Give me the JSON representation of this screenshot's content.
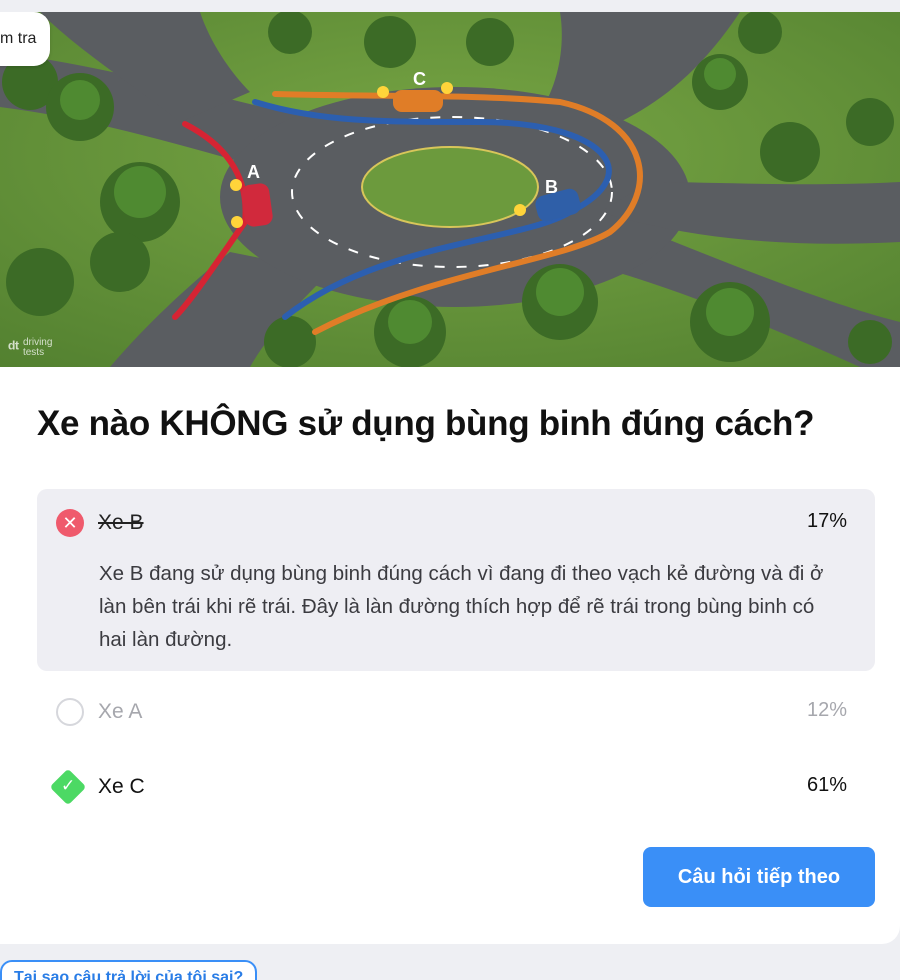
{
  "tag": {
    "label": "m tra"
  },
  "hero": {
    "watermark": "driving\ntests",
    "labels": [
      "A",
      "B",
      "C"
    ]
  },
  "question": {
    "text": "Xe nào KHÔNG sử dụng bùng binh đúng cách?"
  },
  "options": [
    {
      "label": "Xe B",
      "percent": "17%",
      "state": "wrong",
      "explanation": "Xe B đang sử dụng bùng binh đúng cách vì đang đi theo vạch kẻ đường và đi ở làn bên trái khi rẽ trái. Đây là làn đường thích hợp để rẽ trái trong bùng binh có hai làn đường."
    },
    {
      "label": "Xe A",
      "percent": "12%",
      "state": "unselected"
    },
    {
      "label": "Xe C",
      "percent": "61%",
      "state": "correct"
    }
  ],
  "actions": {
    "next_label": "Câu hỏi tiếp theo",
    "why_label": "Tại sao câu trả lời của tôi sai?"
  },
  "colors": {
    "accent": "#3a8ff7",
    "wrong": "#ef5a6c",
    "correct": "#4cd964",
    "panel": "#eeeef3"
  }
}
